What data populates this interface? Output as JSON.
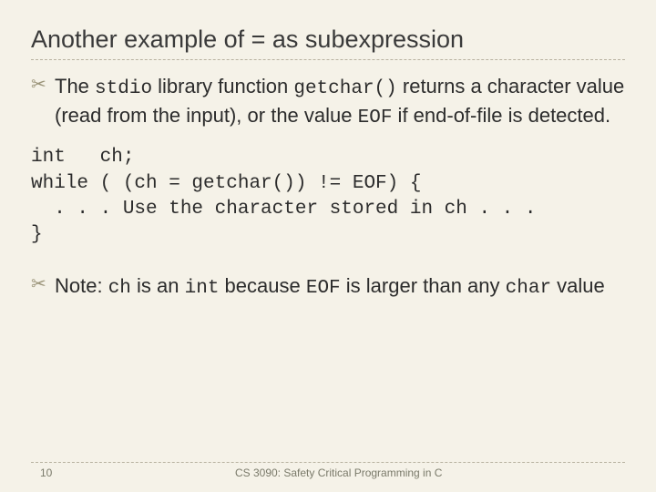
{
  "title": "Another example of = as subexpression",
  "bullets": [
    {
      "pre": "The ",
      "code1": "stdio",
      "mid1": " library function ",
      "code2": "getchar()",
      "mid2": " returns a character value (read from the input), or the value ",
      "code3": "EOF",
      "post": " if end-of-file is detected."
    },
    {
      "pre": "Note: ",
      "code1": "ch",
      "mid1": " is an ",
      "code2": "int",
      "mid2": " because ",
      "code3": "EOF",
      "mid3": " is larger than any ",
      "code4": "char",
      "post": " value"
    }
  ],
  "code": "int   ch;\nwhile ( (ch = getchar()) != EOF) {\n  . . . Use the character stored in ch . . .\n}",
  "footer": {
    "page": "10",
    "text": "CS 3090: Safety Critical Programming in C"
  },
  "bullet_glyph": "✂"
}
